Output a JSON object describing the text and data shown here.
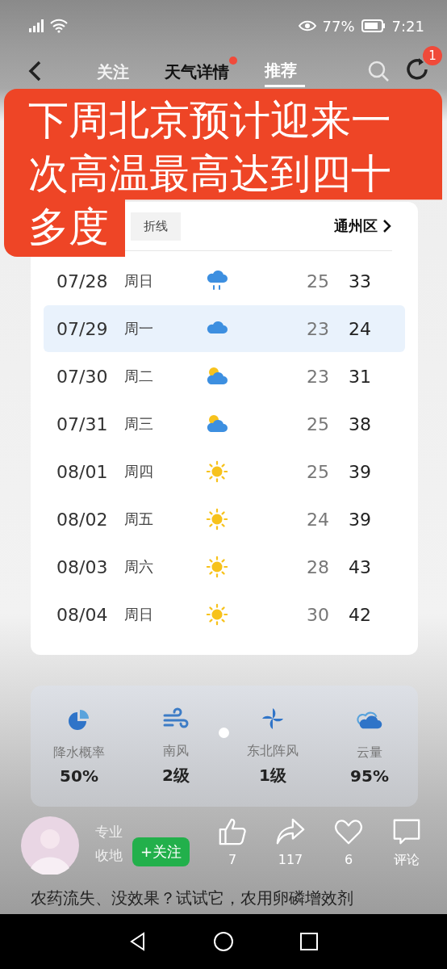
{
  "status_bar": {
    "battery": "77%",
    "time": "7:21"
  },
  "nav": {
    "tabs": [
      {
        "label": "关注",
        "selected": false
      },
      {
        "label": "天气详情",
        "selected": false
      },
      {
        "label": "推荐",
        "selected": true
      }
    ],
    "badge": "1"
  },
  "banner": "下周北京预计迎来一次高温最高达到四十多度",
  "forecast": {
    "toggle": "折线",
    "district": "通州区",
    "rows": [
      {
        "date": "07/28",
        "weekday": "周日",
        "kind": "rain",
        "low": "25",
        "high": "33",
        "selected": false
      },
      {
        "date": "07/29",
        "weekday": "周一",
        "kind": "cloud",
        "low": "23",
        "high": "24",
        "selected": true
      },
      {
        "date": "07/30",
        "weekday": "周二",
        "kind": "partly",
        "low": "23",
        "high": "31",
        "selected": false
      },
      {
        "date": "07/31",
        "weekday": "周三",
        "kind": "partly",
        "low": "25",
        "high": "38",
        "selected": false
      },
      {
        "date": "08/01",
        "weekday": "周四",
        "kind": "sun",
        "low": "25",
        "high": "39",
        "selected": false
      },
      {
        "date": "08/02",
        "weekday": "周五",
        "kind": "sun",
        "low": "24",
        "high": "39",
        "selected": false
      },
      {
        "date": "08/03",
        "weekday": "周六",
        "kind": "sun",
        "low": "28",
        "high": "43",
        "selected": false
      },
      {
        "date": "08/04",
        "weekday": "周日",
        "kind": "sun",
        "low": "30",
        "high": "42",
        "selected": false
      }
    ]
  },
  "stats": [
    {
      "kind": "precip",
      "label": "降水概率",
      "value": "50%"
    },
    {
      "kind": "wind",
      "label": "南风",
      "value": "2级"
    },
    {
      "kind": "gust",
      "label": "东北阵风",
      "value": "1级"
    },
    {
      "kind": "cloud",
      "label": "云量",
      "value": "95%"
    }
  ],
  "author": {
    "name_lines": [
      "专业",
      "收地"
    ],
    "follow": "+关注"
  },
  "actions": [
    {
      "kind": "like",
      "text": "7"
    },
    {
      "kind": "share",
      "text": "117"
    },
    {
      "kind": "heart",
      "text": "6"
    },
    {
      "kind": "comment",
      "text": "评论"
    }
  ],
  "caption": "农药流失、没效果？试试它，农用卵磷增效剂"
}
